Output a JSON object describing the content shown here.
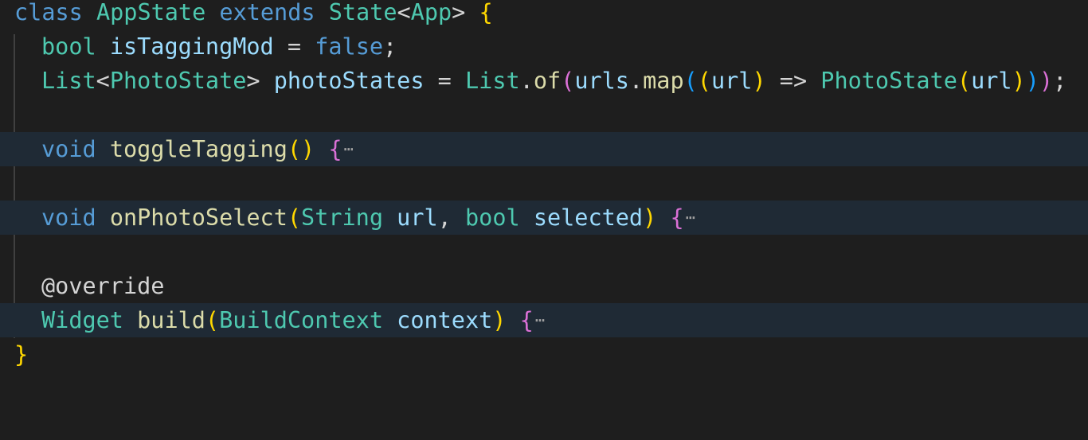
{
  "code": {
    "line1": {
      "kw_class": "class",
      "name": "AppState",
      "kw_extends": "extends",
      "base": "State",
      "lt": "<",
      "generic": "App",
      "gt": ">",
      "brace": "{"
    },
    "line2": {
      "type": "bool",
      "name": "isTaggingMod",
      "eq": "=",
      "value": "false",
      "semi": ";"
    },
    "line3": {
      "type": "List",
      "lt": "<",
      "generic": "PhotoState",
      "gt": ">",
      "name": "photoStates",
      "eq": "=",
      "cls": "List",
      "dot1": ".",
      "method": "of",
      "p1": "(",
      "target": "urls",
      "dot2": ".",
      "map": "map",
      "p2": "(",
      "p3": "(",
      "param": "url",
      "p3c": ")",
      "arrow": "=>",
      "ctor": "PhotoState",
      "p4": "(",
      "arg": "url",
      "p4c": ")",
      "p2c": ")",
      "p1c": ")",
      "semi": ";"
    },
    "line4": {
      "ret": "void",
      "name": "toggleTagging",
      "params": "()",
      "brace": "{",
      "fold": "⋯"
    },
    "line5": {
      "ret": "void",
      "name": "onPhotoSelect",
      "po": "(",
      "t1": "String",
      "a1": "url",
      "comma": ",",
      "t2": "bool",
      "a2": "selected",
      "pc": ")",
      "brace": "{",
      "fold": "⋯"
    },
    "line6": {
      "annotation": "@override"
    },
    "line7": {
      "ret": "Widget",
      "name": "build",
      "po": "(",
      "t1": "BuildContext",
      "a1": "context",
      "pc": ")",
      "brace": "{",
      "fold": "⋯"
    },
    "line8": {
      "brace": "}"
    }
  },
  "colors": {
    "background": "#1e1e1e",
    "folded_line_highlight": "#1f2a35",
    "keyword": "#569cd6",
    "type": "#4ec9b0",
    "function": "#dcdcaa",
    "variable": "#9cdcfe",
    "bracket_level1": "#ffd700",
    "bracket_level2": "#da70d6",
    "bracket_level3": "#179fff"
  }
}
